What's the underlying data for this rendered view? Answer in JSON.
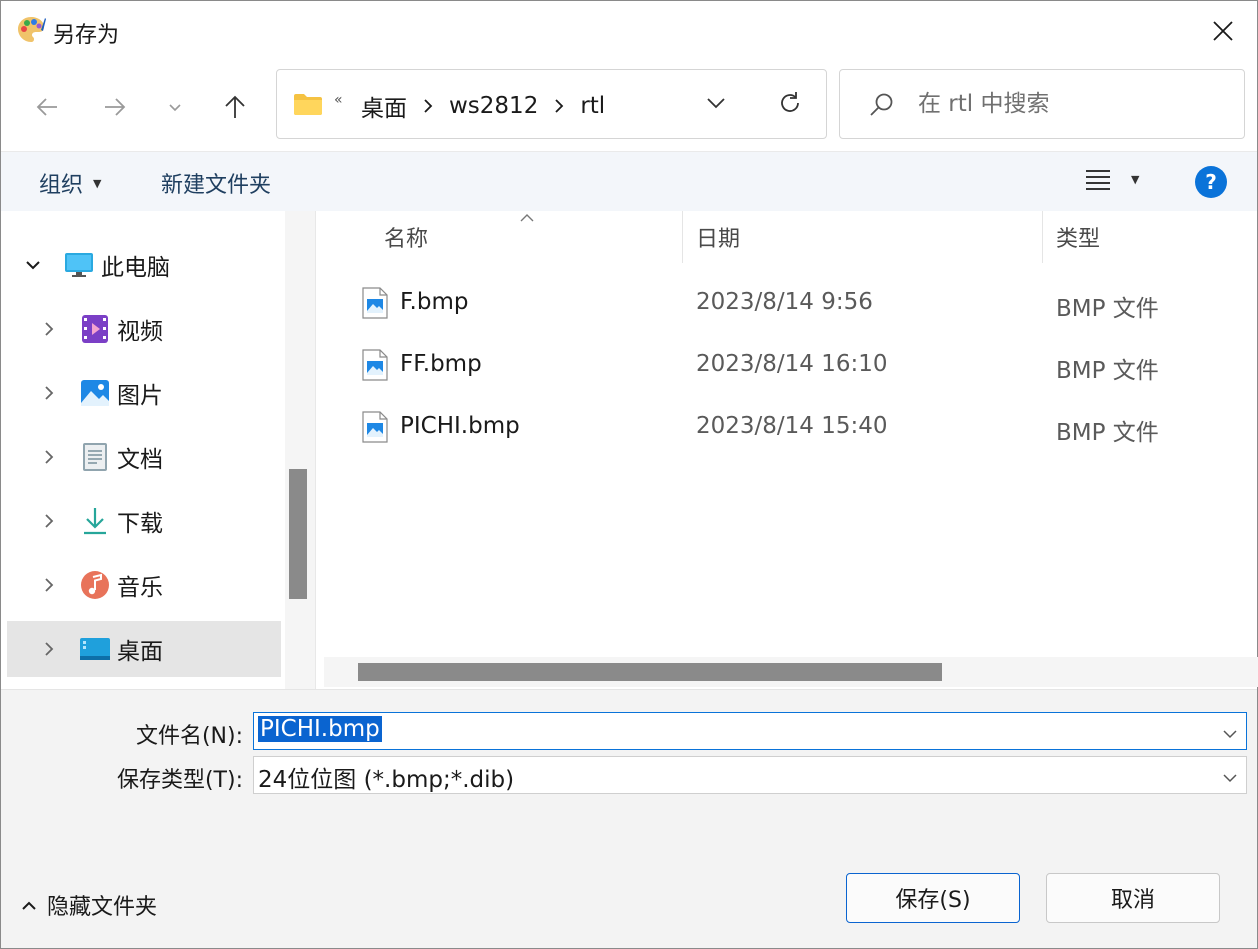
{
  "window": {
    "title": "另存为",
    "app_icon": "paint-palette-icon",
    "close_icon": "close-icon"
  },
  "nav": {
    "back_icon": "arrow-left-icon",
    "forward_icon": "arrow-right-icon",
    "recent_icon": "chevron-down-icon",
    "up_icon": "arrow-up-icon"
  },
  "address": {
    "overflow_indicator": "«",
    "crumbs": [
      "桌面",
      "ws2812",
      "rtl"
    ],
    "folder_icon": "folder-icon",
    "dropdown_icon": "chevron-down-icon",
    "refresh_icon": "refresh-icon"
  },
  "search": {
    "placeholder": "在 rtl 中搜索",
    "value": ""
  },
  "toolbar": {
    "organize_label": "组织",
    "new_folder_label": "新建文件夹",
    "view_icon": "list-view-icon",
    "help_label": "?"
  },
  "tree": {
    "items": [
      {
        "label": "此电脑",
        "icon": "monitor-icon",
        "expanded": true,
        "selected": false
      },
      {
        "label": "视频",
        "icon": "video-icon",
        "expanded": false,
        "selected": false
      },
      {
        "label": "图片",
        "icon": "pictures-icon",
        "expanded": false,
        "selected": false
      },
      {
        "label": "文档",
        "icon": "documents-icon",
        "expanded": false,
        "selected": false
      },
      {
        "label": "下载",
        "icon": "download-icon",
        "expanded": false,
        "selected": false
      },
      {
        "label": "音乐",
        "icon": "music-icon",
        "expanded": false,
        "selected": false
      },
      {
        "label": "桌面",
        "icon": "desktop-icon",
        "expanded": false,
        "selected": true
      }
    ]
  },
  "columns": {
    "name": "名称",
    "date": "日期",
    "type": "类型"
  },
  "files": [
    {
      "name": "F.bmp",
      "date": "2023/8/14 9:56",
      "type": "BMP 文件",
      "icon": "bitmap-file-icon"
    },
    {
      "name": "FF.bmp",
      "date": "2023/8/14 16:10",
      "type": "BMP 文件",
      "icon": "bitmap-file-icon"
    },
    {
      "name": "PICHI.bmp",
      "date": "2023/8/14 15:40",
      "type": "BMP 文件",
      "icon": "bitmap-file-icon"
    }
  ],
  "form": {
    "filename_label": "文件名(N):",
    "filename_value": "PICHI.bmp",
    "filetype_label": "保存类型(T):",
    "filetype_value": "24位位图 (*.bmp;*.dib)"
  },
  "footer": {
    "hide_folders_label": "隐藏文件夹",
    "save_label": "保存(S)",
    "cancel_label": "取消"
  },
  "colors": {
    "accent": "#0a73d9",
    "selection": "#0a64d0",
    "toolbar_bg": "#f3f6fa",
    "footer_bg": "#f3f3f3"
  }
}
